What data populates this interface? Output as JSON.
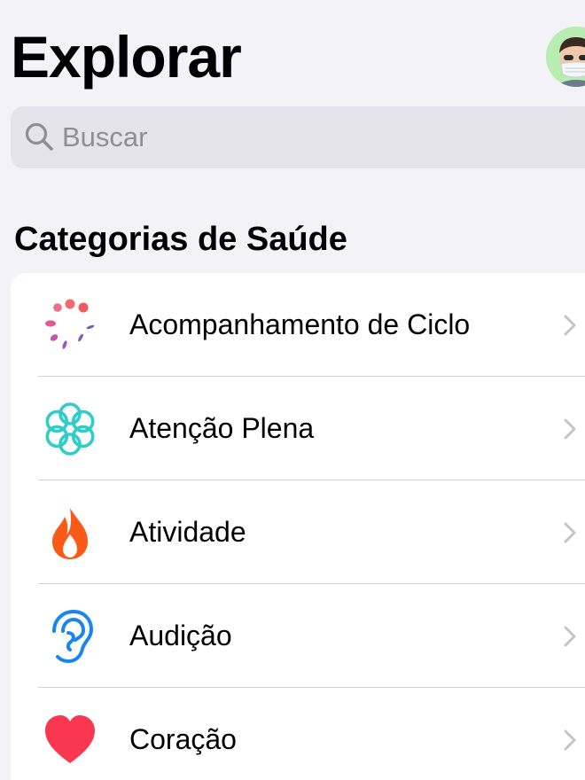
{
  "header": {
    "title": "Explorar",
    "avatar_icon": "memoji-avatar-icon",
    "avatar_bg": "#B8ECB0"
  },
  "search": {
    "placeholder": "Buscar",
    "icon": "search-icon"
  },
  "section": {
    "title": "Categorias de Saúde"
  },
  "categories": [
    {
      "label": "Acompanhamento de Ciclo",
      "icon": "cycle-tracking-icon",
      "color": "#F0506E"
    },
    {
      "label": "Atenção Plena",
      "icon": "mindfulness-icon",
      "color": "#2FCDC8"
    },
    {
      "label": "Atividade",
      "icon": "flame-icon",
      "color": "#FA5A17"
    },
    {
      "label": "Audição",
      "icon": "ear-icon",
      "color": "#1A84F0"
    },
    {
      "label": "Coração",
      "icon": "heart-icon",
      "color": "#FA3750"
    }
  ],
  "colors": {
    "background": "#F2F2F7",
    "card": "#FFFFFF",
    "search_bg": "#E4E4EA",
    "placeholder": "#8E8E93",
    "separator": "#D1D1D6",
    "chevron": "#C4C4C9"
  }
}
